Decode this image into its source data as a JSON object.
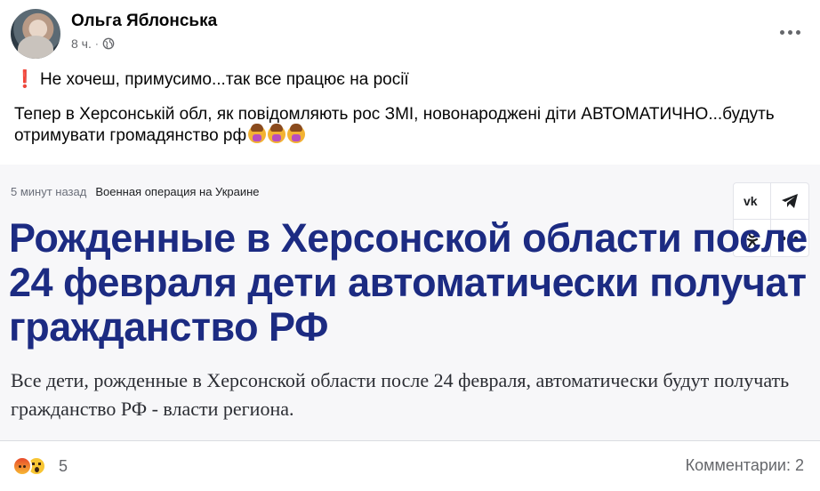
{
  "post": {
    "author": "Ольга Яблонська",
    "time": "8 ч.",
    "separator": "·",
    "privacy_icon": "globe-icon",
    "more_icon": "more-horizontal-icon",
    "text_line1_icon": "exclamation-icon",
    "text_line1_icon_glyph": "❗",
    "text_line1": "Не хочеш, примусимо...так все працює на росії",
    "text_line2": "Тепер в Херсонській обл, як повідомляють рос ЗМІ, новонароджені діти АВТОМАТИЧНО...будуть отримувати громадянство рф",
    "text_line2_emojis": [
      "facepalm-emoji",
      "facepalm-emoji",
      "facepalm-emoji"
    ]
  },
  "card": {
    "time_ago": "5 минут назад",
    "category": "Военная операция на Украине",
    "headline": "Рожденные в Херсонской области после 24 февраля дети автоматически получат гражданство РФ",
    "lead": "Все дети, рожденные в Херсонской области после 24 февраля, автоматически будут получать гражданство РФ - власти региона.",
    "share_buttons": [
      {
        "name": "vk-share",
        "label": "vk"
      },
      {
        "name": "telegram-share",
        "label": "➤"
      },
      {
        "name": "ok-share",
        "label": "ꝋ"
      },
      {
        "name": "more-share",
        "label": "•••"
      }
    ],
    "headline_color": "#1c2b82"
  },
  "footer": {
    "reactions": [
      "angry-icon",
      "wow-icon"
    ],
    "reaction_count": "5",
    "comments": "Комментарии: 2"
  }
}
